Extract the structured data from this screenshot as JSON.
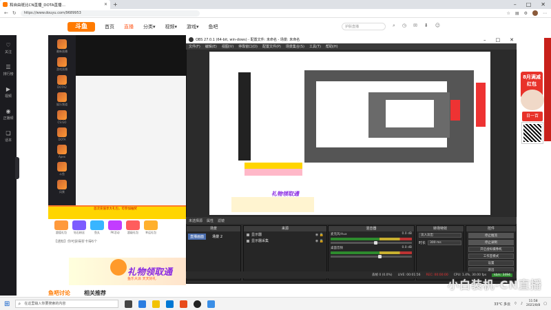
{
  "browser": {
    "tab_title": "和自由斑比CN直播_DOTA直播…",
    "url": "https://www.douyu.com/9689953"
  },
  "site": {
    "logo": "斗鱼",
    "nav": [
      "首页",
      "直播",
      "分类▾",
      "视频▾",
      "游戏▾",
      "鱼吧"
    ],
    "active_nav": "直播",
    "search_placeholder": "护肤直播"
  },
  "rail": {
    "items": [
      "关注",
      "排行榜",
      "视频",
      "正播频",
      "话本",
      "设置"
    ]
  },
  "streamers": [
    "最新直播",
    "游戏直播",
    "DOTA2",
    "娱乐频道",
    "CS:GO",
    "DOTA",
    "Apex",
    "斗鱼",
    "风景"
  ],
  "left": {
    "popup_text": "首次充值享大礼包，可参加抽奖",
    "gift_labels": [
      "超值礼包",
      "钻石粉丝",
      "鱼丸",
      "PK活动",
      "超级礼包",
      "幸运礼包"
    ],
    "fan_text": "【通知】你可获得折卡得6个",
    "banner_title": "礼物领取通",
    "banner_sub": "鱼乐大派   天天好礼",
    "tab_active": "鱼吧讨论",
    "tab_other": "相关推荐"
  },
  "obs": {
    "title": "OBS 27.0.1 (64-bit, win-dows) - 配置文件: 未命名 - 场景: 未命名",
    "menu": [
      "文件(F)",
      "编辑(E)",
      "视图(V)",
      "停靠窗口(D)",
      "配置文件(P)",
      "场景集合(S)",
      "工具(T)",
      "帮助(H)"
    ],
    "scene_bar": [
      "未选择源",
      "属性",
      "滤镜"
    ],
    "docks": {
      "scenes": "场景",
      "sources": "来源",
      "mixer": "混音器",
      "transitions": "转场特效",
      "controls": "控件"
    },
    "scene_items": [
      "直播画面",
      "场景 2"
    ],
    "sources": [
      "显示器",
      "显示器采集"
    ],
    "mixer": [
      {
        "name": "桌面音频",
        "db": "0.0 dB",
        "level": 0.6
      },
      {
        "name": "麦克风/Aux",
        "db": "0.0 dB",
        "level": 0.55
      }
    ],
    "transition": {
      "type": "淡入淡出",
      "duration_label": "时长",
      "duration": "300 ms"
    },
    "controls": [
      "停止推流",
      "停止录制",
      "开启虚拟摄像机",
      "工作室模式",
      "设置",
      "退出"
    ],
    "status": {
      "dropped": "丢帧 0 (0.0%)",
      "live": "LIVE: 00:01:56",
      "rec": "REC: 00:00:00",
      "cpu": "CPU: 1.4%, 30.00 fps",
      "kbps": "kb/s: 3494"
    },
    "preview_banner": "礼物领取通"
  },
  "right_ads": {
    "promo_title": "8月满减红包",
    "promo_sub": "日一百",
    "qr_label": "扫码"
  },
  "taskbar": {
    "search": "在这里输入你要搜索的内容",
    "weather": "33°C 多云",
    "time": "11:58",
    "date": "2021/8/8"
  },
  "watermark": "小白装机-CN直播"
}
